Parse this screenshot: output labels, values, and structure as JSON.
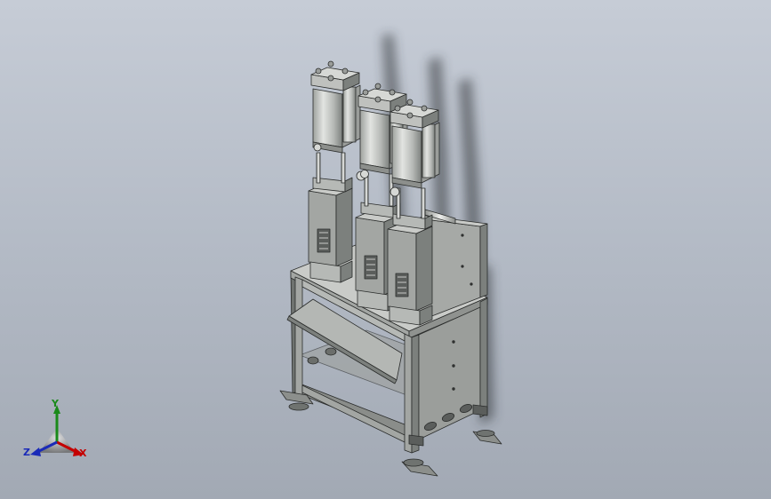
{
  "colors": {
    "background_top": "#c6ccd6",
    "background_bottom": "#a2a9b4",
    "part_light": "#c9cbc8",
    "part_mid": "#a3a6a3",
    "part_dark": "#6f7370",
    "edge": "#2a2c2b",
    "axis_x": "#c40000",
    "axis_y": "#1a8a1a",
    "axis_z": "#1a2ab8"
  },
  "triad": {
    "x_label": "X",
    "y_label": "Y",
    "z_label": "Z"
  },
  "icons": {
    "triad": "coordinate-triad-icon"
  }
}
